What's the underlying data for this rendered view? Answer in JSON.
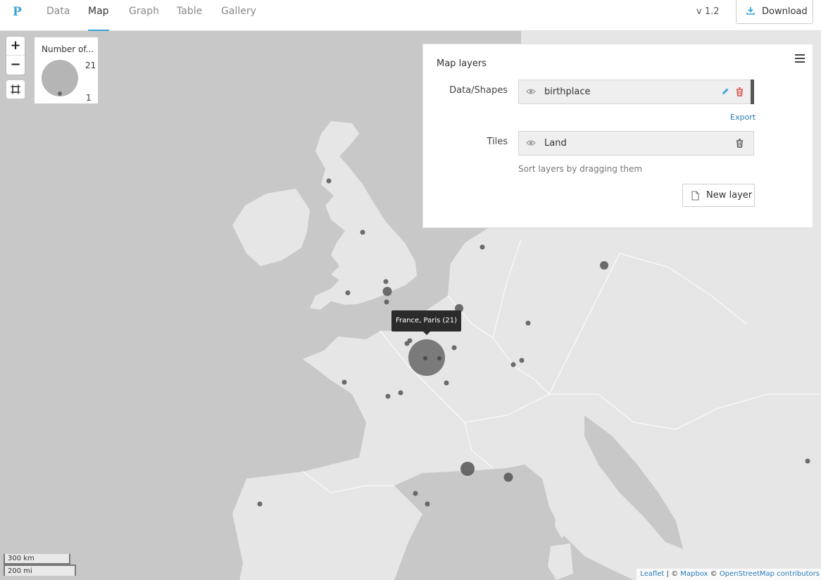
{
  "nav": {
    "logo": "P",
    "tabs": [
      {
        "label": "Data",
        "active": false
      },
      {
        "label": "Map",
        "active": true
      },
      {
        "label": "Graph",
        "active": false
      },
      {
        "label": "Table",
        "active": false
      },
      {
        "label": "Gallery",
        "active": false
      }
    ],
    "version": "v 1.2",
    "download_label": "Download"
  },
  "map": {
    "zoom_in": "+",
    "zoom_out": "−",
    "legend": {
      "title": "Number of...",
      "max": "21",
      "min": "1"
    },
    "tooltip": "France, Paris (21)",
    "scale_km": "300 km",
    "scale_mi": "200 mi",
    "attribution": {
      "leaflet": "Leaflet",
      "sep1": " | © ",
      "mapbox": "Mapbox",
      "sep2": " © ",
      "osm": "OpenStreetMap contributors"
    },
    "colors": {
      "water": "#c8c8c8",
      "land": "#e6e6e6",
      "marker": "#555555"
    }
  },
  "layers_panel": {
    "title": "Map layers",
    "data_label": "Data/Shapes",
    "data_layer": "birthplace",
    "export": "Export",
    "tiles_label": "Tiles",
    "tiles_layer": "Land",
    "hint": "Sort layers by dragging them",
    "new_layer": "New layer"
  }
}
